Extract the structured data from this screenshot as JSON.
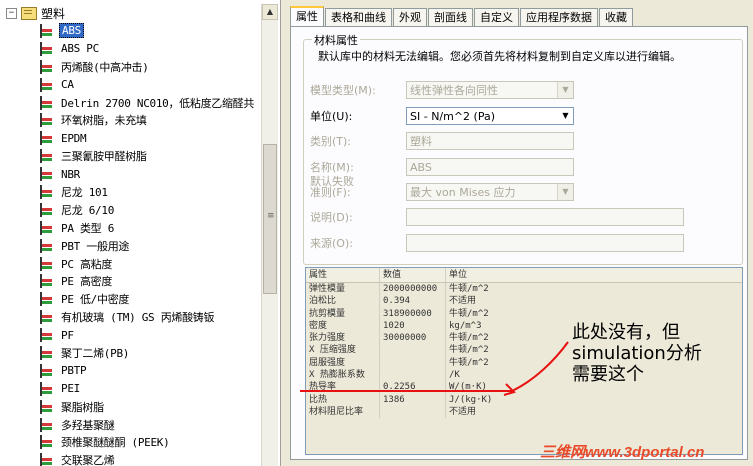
{
  "tree": {
    "root_label": "塑料",
    "items": [
      {
        "label": "ABS",
        "selected": true
      },
      {
        "label": "ABS PC"
      },
      {
        "label": "丙烯酸(中高冲击)"
      },
      {
        "label": "CA"
      },
      {
        "label": "Delrin 2700 NC010，低粘度乙缩醛共"
      },
      {
        "label": "环氧树脂，未充填"
      },
      {
        "label": "EPDM"
      },
      {
        "label": "三聚氰胺甲醛树脂"
      },
      {
        "label": "NBR"
      },
      {
        "label": "尼龙 101"
      },
      {
        "label": "尼龙 6/10"
      },
      {
        "label": "PA 类型 6"
      },
      {
        "label": "PBT 一般用途"
      },
      {
        "label": "PC 高粘度"
      },
      {
        "label": "PE 高密度"
      },
      {
        "label": "PE 低/中密度"
      },
      {
        "label": "有机玻璃 (TM) GS 丙烯酸铸钣"
      },
      {
        "label": "PF"
      },
      {
        "label": "聚丁二烯(PB)"
      },
      {
        "label": "PBTP"
      },
      {
        "label": "PEI"
      },
      {
        "label": "聚脂树脂"
      },
      {
        "label": "多羟基聚醚"
      },
      {
        "label": "颈椎聚醚醚酮 (PEEK)"
      },
      {
        "label": "交联聚乙烯"
      }
    ]
  },
  "tabs": [
    {
      "label": "属性",
      "active": true
    },
    {
      "label": "表格和曲线"
    },
    {
      "label": "外观"
    },
    {
      "label": "剖面线"
    },
    {
      "label": "自定义"
    },
    {
      "label": "应用程序数据"
    },
    {
      "label": "收藏"
    }
  ],
  "material_group": {
    "title": "材料属性",
    "note": "默认库中的材料无法编辑。您必须首先将材料复制到自定义库以进行编辑。",
    "fields": {
      "model_type": {
        "label": "模型类型(M):",
        "value": "线性弹性各向同性"
      },
      "units": {
        "label": "单位(U):",
        "value": "SI - N/m^2 (Pa)"
      },
      "category": {
        "label": "类别(T):",
        "value": "塑料"
      },
      "name": {
        "label": "名称(M):",
        "value": "ABS"
      },
      "failure_line1": {
        "label": "默认失败"
      },
      "failure": {
        "label": "准则(F):",
        "value": "最大 von Mises 应力"
      },
      "description": {
        "label": "说明(D):",
        "value": ""
      },
      "source": {
        "label": "来源(O):",
        "value": ""
      }
    }
  },
  "property_table": {
    "headers": [
      "属性",
      "数值",
      "单位"
    ],
    "rows": [
      [
        "弹性模量",
        "2000000000",
        "牛顿/m^2"
      ],
      [
        "泊松比",
        "0.394",
        "不适用"
      ],
      [
        "抗剪模量",
        "318900000",
        "牛顿/m^2"
      ],
      [
        "密度",
        "1020",
        "kg/m^3"
      ],
      [
        "张力强度",
        "30000000",
        "牛顿/m^2"
      ],
      [
        "X 压缩强度",
        "",
        "牛顿/m^2"
      ],
      [
        "屈服强度",
        "",
        "牛顿/m^2"
      ],
      [
        "X 热膨胀系数",
        "",
        "/K"
      ],
      [
        "热导率",
        "0.2256",
        "W/(m·K)"
      ],
      [
        "比热",
        "1386",
        "J/(kg·K)"
      ],
      [
        "材料阻尼比率",
        "",
        "不适用"
      ]
    ]
  },
  "annotation": {
    "line1": "此处没有，但",
    "line2": "simulation分析",
    "line3": "需要这个",
    "color": "#e81010"
  },
  "watermark": "三维网www.3dportal.cn"
}
